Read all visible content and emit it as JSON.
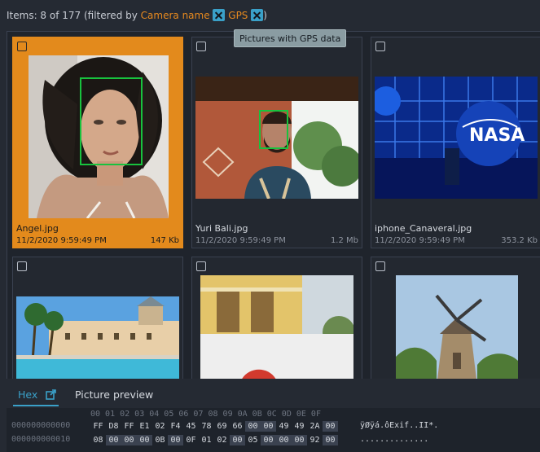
{
  "filter": {
    "items_text": "Items: 8 of 177 (filtered by",
    "tag1": "Camera name",
    "tag2": "GPS",
    "closing": ")"
  },
  "tooltip": "Pictures with GPS data",
  "cards": [
    {
      "name": "Angel.jpg",
      "date": "11/2/2020 9:59:49 PM",
      "size": "147 Kb"
    },
    {
      "name": "Yuri Bali.jpg",
      "date": "11/2/2020 9:59:49 PM",
      "size": "1.2 Mb"
    },
    {
      "name": "iphone_Canaveral.jpg",
      "date": "11/2/2020 9:59:49 PM",
      "size": "353.2 Kb"
    }
  ],
  "tabs": {
    "hex": "Hex",
    "preview": "Picture preview"
  },
  "hex": {
    "header": "00 01 02 03 04 05 06 07 08 09 0A 0B 0C 0D 0E 0F",
    "rows": [
      {
        "addr": "000000000000",
        "bytes": [
          "FF",
          "D8",
          "FF",
          "E1",
          "02",
          "F4",
          "45",
          "78",
          "69",
          "66",
          "00",
          "00",
          "49",
          "49",
          "2A",
          "00"
        ],
        "ascii": "ÿØÿá.ôExif..II*."
      },
      {
        "addr": "000000000010",
        "bytes": [
          "08",
          "00",
          "00",
          "00",
          "0B",
          "00",
          "0F",
          "01",
          "02",
          "00",
          "05",
          "00",
          "00",
          "00",
          "92",
          "00"
        ],
        "ascii": ".............."
      }
    ]
  },
  "colors": {
    "accent_orange": "#e38a1c",
    "accent_blue": "#3aa0c8",
    "face_box": "#18c23e"
  }
}
